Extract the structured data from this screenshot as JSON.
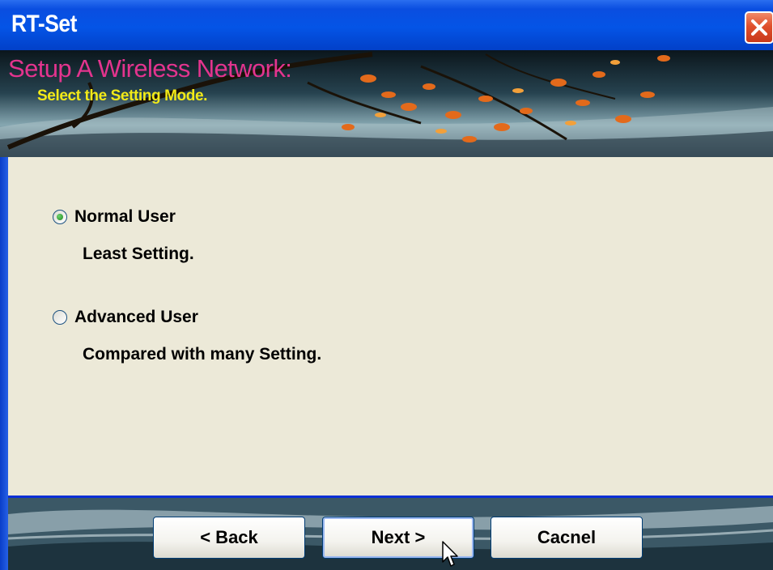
{
  "window": {
    "title": "RT-Set"
  },
  "banner": {
    "title": "Setup A Wireless Network:",
    "subtitle": "Select the Setting Mode."
  },
  "options": [
    {
      "label": "Normal User",
      "description": "Least Setting.",
      "selected": true
    },
    {
      "label": "Advanced User",
      "description": "Compared with many Setting.",
      "selected": false
    }
  ],
  "buttons": {
    "back": "< Back",
    "next": "Next >",
    "cancel": "Cacnel"
  },
  "icons": {
    "close": "close-icon",
    "cursor": "mouse-pointer-icon"
  },
  "colors": {
    "titlebar": "#0454e6",
    "banner_title": "#e3348e",
    "banner_subtitle": "#f2ea18",
    "content_bg": "#ece9d8",
    "separator": "#0a2fd6"
  }
}
